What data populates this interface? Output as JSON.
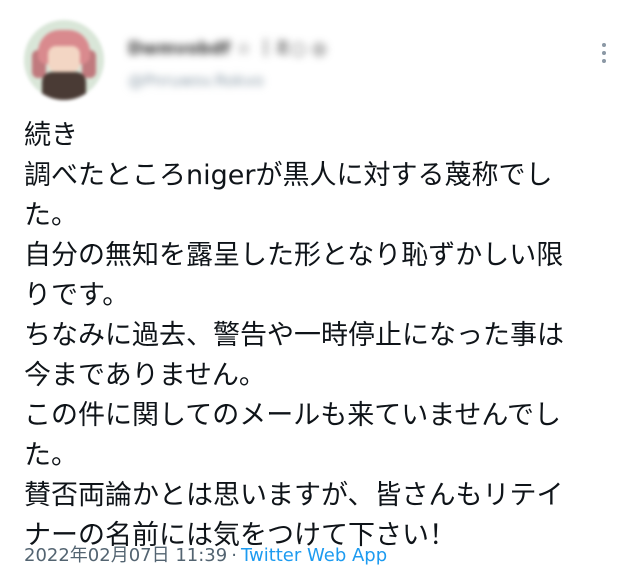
{
  "author": {
    "display_name": "Dwmvobdf ☆ ｜ミ○ ◎",
    "handle": "@Pnruwsv.Rokvo"
  },
  "tweet": {
    "lines": [
      "続き",
      "調べたところnigerが黒人に対する蔑称でし",
      "た。",
      "自分の無知を露呈した形となり恥ずかしい限",
      "りです。",
      "ちなみに過去、警告や一時停止になった事は",
      "今までありません。",
      "この件に関してのメールも来ていませんでし",
      "た。",
      "賛否両論かとは思いますが、皆さんもリテイ",
      "ナーの名前には気をつけて下さい！"
    ]
  },
  "meta": {
    "timestamp": "2022年02月07日 11:39",
    "separator": "·",
    "source": "Twitter Web App"
  },
  "colors": {
    "text": "#0f1419",
    "meta": "#536471",
    "link": "#1d9bf0"
  },
  "icons": {
    "more": "vertical-ellipsis"
  }
}
